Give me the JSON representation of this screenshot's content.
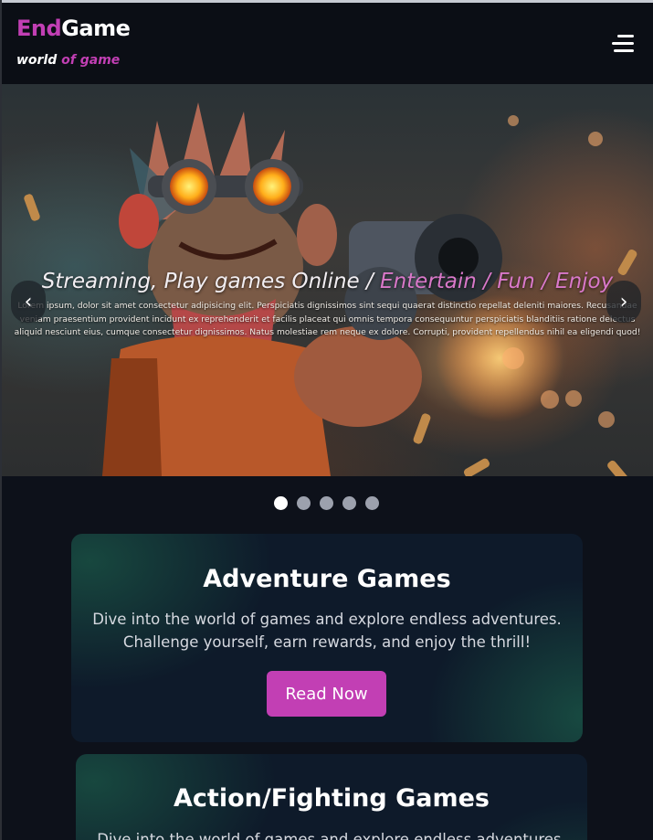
{
  "header": {
    "logo_part1": "End",
    "logo_part2": "Game",
    "tagline_part1": "world",
    "tagline_part2": "of game",
    "menu_icon": "hamburger-menu-icon"
  },
  "hero": {
    "title_part1": "Streaming, Play games Online / ",
    "title_part2": "Entertain / Fun / Enjoy",
    "text": "Lorem ipsum, dolor sit amet consectetur adipisicing elit. Perspiciatis dignissimos sint sequi quaerat distinctio repellat deleniti maiores. Recusandae veniam praesentium provident incidunt ex reprehenderit et facilis placeat qui omnis tempora consequuntur perspiciatis blanditiis ratione delectus aliquid nesciunt eius, cumque consectetur dignissimos. Natus molestiae rem neque ex dolore. Corrupti, provident repellendus nihil ea eligendi quod!",
    "prev_label": "‹",
    "next_label": "›",
    "slide_count": 5,
    "active_slide": 1
  },
  "cards": [
    {
      "title": "Adventure Games",
      "description": "Dive into the world of games and explore endless adventures. Challenge yourself, earn rewards, and enjoy the thrill!",
      "button_label": "Read Now"
    },
    {
      "title": "Action/Fighting Games",
      "description": "Dive into the world of games and explore endless adventures."
    }
  ],
  "colors": {
    "accent": "#c23fb4",
    "background": "#0d111a",
    "card_bg": "#0e1a2a"
  }
}
